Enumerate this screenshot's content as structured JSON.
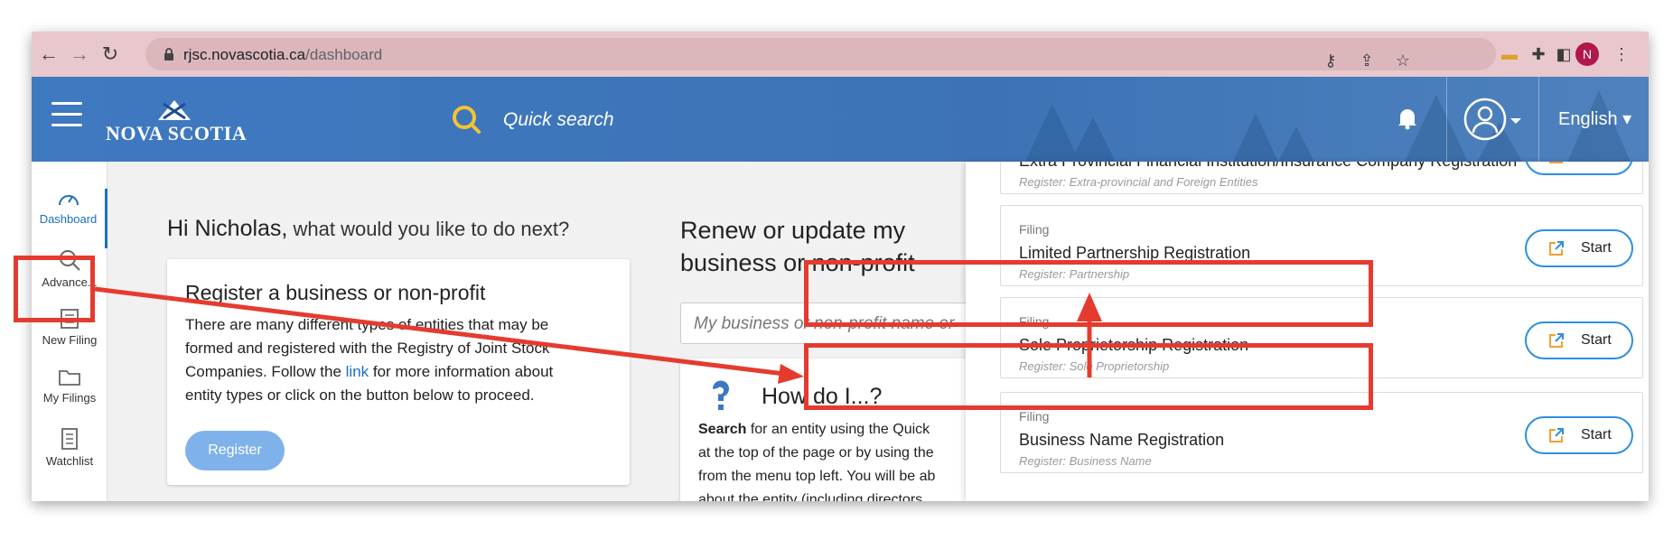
{
  "browser": {
    "url_domain": "rjsc.novascotia.ca",
    "url_path": "/dashboard",
    "profile_initial": "N",
    "icons": [
      "back-icon",
      "forward-icon",
      "reload-icon",
      "lock-icon",
      "key-icon",
      "share-icon",
      "star-icon",
      "extension-icon",
      "puzzle-icon",
      "sidepanel-icon",
      "menu-icon"
    ]
  },
  "header": {
    "logo_text": "NOVA SCOTIA",
    "quick_search": "Quick search",
    "language": "English"
  },
  "sidebar": {
    "items": [
      {
        "label": "Dashboard",
        "icon": "gauge-icon",
        "active": true
      },
      {
        "label": "Advance...",
        "icon": "search-icon",
        "active": false
      },
      {
        "label": "New Filing",
        "icon": "form-icon",
        "active": false
      },
      {
        "label": "My Filings",
        "icon": "folder-icon",
        "active": false
      },
      {
        "label": "Watchlist",
        "icon": "list-icon",
        "active": false
      }
    ]
  },
  "main": {
    "greeting_name": "Hi Nicholas,",
    "greeting_question": " what would you like to do next?",
    "register_card": {
      "title": "Register a business or non-profit",
      "body_before_link": "There are many different types of entities that may be formed and registered with the Registry of Joint Stock Companies. Follow the ",
      "link_text": "link",
      "body_after_link": " for more information about entity types or click on the button below to proceed.",
      "button": "Register"
    },
    "renew": {
      "title": "Renew or update my business or non-profit",
      "search_placeholder": "My business or non-profit name or"
    },
    "how_card": {
      "title": "How do I...?",
      "bold": "Search",
      "line1": " for an entity using the Quick",
      "line2": "at the top of the page or by using the",
      "line3": "from the menu top left. You will be ab",
      "line4": "about the entity (including directors..."
    }
  },
  "panel": {
    "cards": [
      {
        "category": "",
        "name": "Extra Provincial Financial Institution/Insurance Company Registration",
        "register": "Register: Extra-provincial and Foreign Entities",
        "button": "Start"
      },
      {
        "category": "Filing",
        "name": "Limited Partnership Registration",
        "register": "Register: Partnership",
        "button": "Start"
      },
      {
        "category": "Filing",
        "name": "Sole Proprietorship Registration",
        "register": "Register: Sole Proprietorship",
        "button": "Start"
      },
      {
        "category": "Filing",
        "name": "Business Name Registration",
        "register": "Register: Business Name",
        "button": "Start"
      }
    ]
  },
  "annotation": {
    "color": "#e53b2f"
  }
}
